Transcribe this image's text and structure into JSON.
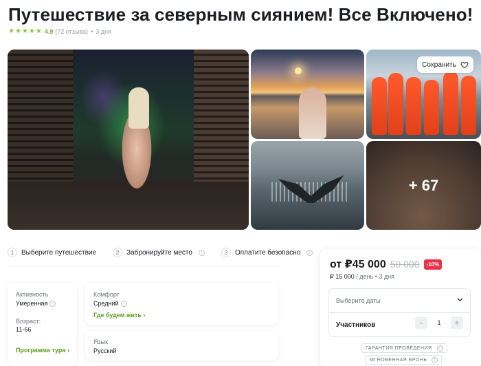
{
  "header": {
    "title": "Путешествие за северным сиянием! Все Включено!",
    "rating": "4.9",
    "reviews": "(72 отзыва)",
    "duration": "3 дня"
  },
  "gallery": {
    "save_label": "Сохранить",
    "more_photos": "+ 67"
  },
  "steps": [
    {
      "num": "1",
      "label": "Выберите путешествие"
    },
    {
      "num": "2",
      "label": "Забронируйте место"
    },
    {
      "num": "3",
      "label": "Оплатите безопасно"
    }
  ],
  "details": {
    "activity_label": "Активность",
    "activity_value": "Умеренная",
    "age_label": "Возраст:",
    "age_value": "11-66",
    "program_link": "Программа тура",
    "comfort_label": "Комфорт",
    "comfort_value": "Средний",
    "stay_link": "Где будем жить",
    "language_label": "Язык",
    "language_value": "Русский"
  },
  "booking": {
    "price": "от ₽45 000",
    "old_price": "50 000",
    "discount": "-10%",
    "per_day_price": "₽ 15 000",
    "per_day_suffix": "/ день",
    "days": "3 дня",
    "dates_placeholder": "Выберите даты",
    "participants_label": "Участников",
    "participants_count": "1",
    "minus": "-",
    "plus": "+",
    "badge_guarantee": "ГАРАНТИЯ ПРОВЕДЕНИЯ",
    "badge_instant": "МГНОВЕННАЯ БРОНЬ"
  },
  "colors": {
    "accent_green": "#5c9e1f",
    "discount_red": "#e8334a",
    "star": "#8cc63f"
  }
}
